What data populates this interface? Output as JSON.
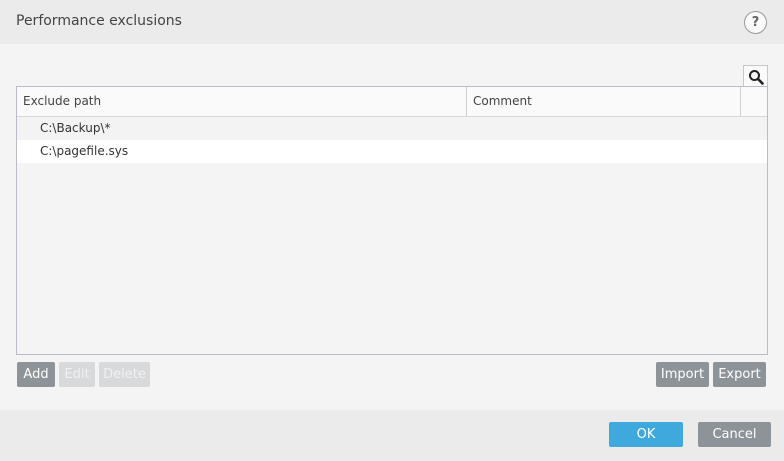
{
  "window": {
    "title": "Performance exclusions",
    "help_label": "?"
  },
  "icons": {
    "help": "help-icon",
    "search": "search-icon"
  },
  "table": {
    "columns": [
      "Exclude path",
      "Comment"
    ],
    "rows": [
      {
        "path": "C:\\Backup\\*",
        "comment": ""
      },
      {
        "path": "C:\\pagefile.sys",
        "comment": ""
      }
    ]
  },
  "actions": {
    "add": "Add",
    "edit": "Edit",
    "delete": "Delete",
    "import": "Import",
    "export": "Export"
  },
  "footer": {
    "ok": "OK",
    "cancel": "Cancel"
  },
  "colors": {
    "accent": "#3fa9dd",
    "button_gray": "#8c9399",
    "disabled": "#d7d9db"
  }
}
